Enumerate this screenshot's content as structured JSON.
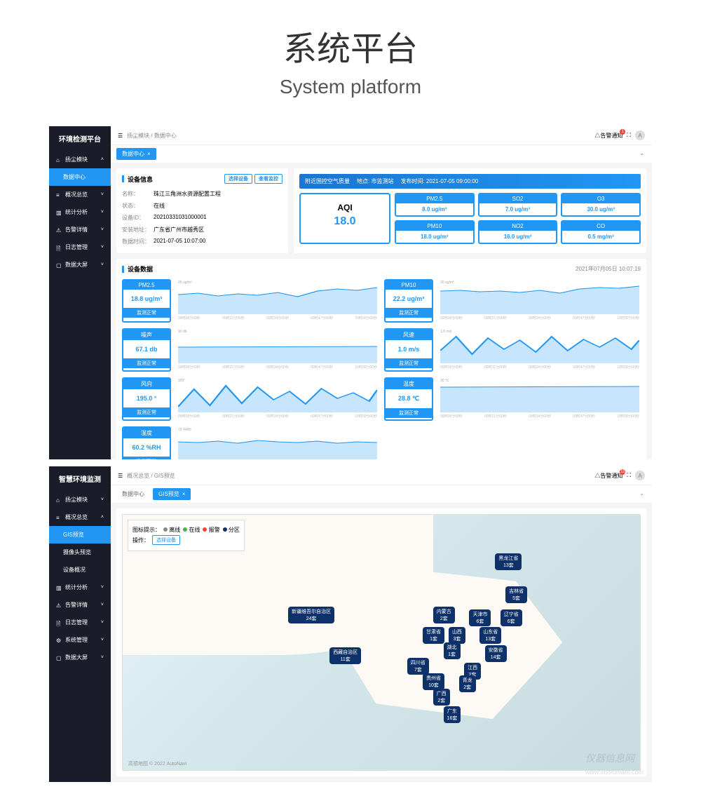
{
  "header": {
    "title_cn": "系统平台",
    "title_en": "System platform"
  },
  "dashboard1": {
    "sidebar": {
      "title": "环境检测平台",
      "items": [
        {
          "icon": "home",
          "label": "扬尘模块",
          "expanded": true
        },
        {
          "icon": "",
          "label": "数据中心",
          "active": true,
          "sub": true
        },
        {
          "icon": "bars",
          "label": "概况总览"
        },
        {
          "icon": "chart",
          "label": "统计分析"
        },
        {
          "icon": "warn",
          "label": "告警详情"
        },
        {
          "icon": "doc",
          "label": "日志管理"
        },
        {
          "icon": "screen",
          "label": "数据大屏"
        }
      ]
    },
    "breadcrumb": "扬尘模块 / 数据中心",
    "user_label": "告警通知",
    "notif_count": "1",
    "avatar_initial": "A",
    "tabs": [
      {
        "label": "数据中心",
        "closable": true
      }
    ],
    "device_info": {
      "title": "设备信息",
      "btn_select": "选择设备",
      "btn_view": "查看监控",
      "rows": [
        {
          "lbl": "名称：",
          "val": "珠江三角洲水资源配置工程"
        },
        {
          "lbl": "状态：",
          "val": "在线"
        },
        {
          "lbl": "设备ID：",
          "val": "20210331031000001"
        },
        {
          "lbl": "安装地址：",
          "val": "广东省广州市越秀区"
        },
        {
          "lbl": "数据时间：",
          "val": "2021-07-05 10:07:00"
        }
      ]
    },
    "air": {
      "header_title": "附近国控空气质量",
      "header_site": "地点: 市监测站",
      "header_time": "发布时间: 2021-07-05 09:00:00",
      "aqi_label": "AQI",
      "aqi_value": "18.0",
      "pollutants": [
        {
          "name": "PM2.5",
          "val": "8.0 ug/m³"
        },
        {
          "name": "SO2",
          "val": "7.0 ug/m³"
        },
        {
          "name": "O3",
          "val": "30.0 ug/m³"
        },
        {
          "name": "PM10",
          "val": "18.0 ug/m³"
        },
        {
          "name": "NO2",
          "val": "16.0 ug/m³"
        },
        {
          "name": "CO",
          "val": "0.5 mg/m³"
        }
      ]
    },
    "device_data": {
      "title": "设备数据",
      "timestamp": "2021年07月05日 10:07:19",
      "status_normal": "监测正常",
      "metrics": [
        {
          "name": "PM2.5",
          "val": "18.8 ug/m³",
          "ymax": "25 ug/m³"
        },
        {
          "name": "PM10",
          "val": "22.2 ug/m³",
          "ymax": "30 ug/m³"
        },
        {
          "name": "噪声",
          "val": "67.1 db",
          "ymax": "90 db"
        },
        {
          "name": "风速",
          "val": "1.0 m/s",
          "ymax": "1.8 m/s"
        },
        {
          "name": "风向",
          "val": "195.0 °",
          "ymax": "300°"
        },
        {
          "name": "温度",
          "val": "28.8 ℃",
          "ymax": "30 ℃"
        },
        {
          "name": "湿度",
          "val": "60.2 %RH",
          "ymax": "70 %RH"
        }
      ],
      "x_ticks": [
        "09时08分00秒",
        "09时21分00秒",
        "09时34分00秒",
        "09时47分00秒",
        "10时00分00秒"
      ]
    }
  },
  "dashboard2": {
    "sidebar": {
      "title": "智慧环境监测",
      "items": [
        {
          "icon": "home",
          "label": "扬尘模块"
        },
        {
          "icon": "bars",
          "label": "概况总览",
          "expanded": true
        },
        {
          "icon": "",
          "label": "GIS预览",
          "active": true,
          "sub": true
        },
        {
          "icon": "",
          "label": "摄像头预览",
          "sub": true
        },
        {
          "icon": "",
          "label": "设备概况",
          "sub": true
        },
        {
          "icon": "chart",
          "label": "统计分析"
        },
        {
          "icon": "warn",
          "label": "告警详情"
        },
        {
          "icon": "doc",
          "label": "日志管理"
        },
        {
          "icon": "gear",
          "label": "系统管理"
        },
        {
          "icon": "screen",
          "label": "数据大屏"
        }
      ]
    },
    "breadcrumb": "概况总览 / GIS预览",
    "user_label": "告警通知",
    "notif_count": "11",
    "avatar_initial": "A",
    "tabs": [
      {
        "label": "数据中心",
        "plain": true
      },
      {
        "label": "GIS预览",
        "closable": true
      }
    ],
    "legend": {
      "title": "图标提示：",
      "items": [
        {
          "color": "#888",
          "label": "离线"
        },
        {
          "color": "#4caf50",
          "label": "在线"
        },
        {
          "color": "#f44336",
          "label": "报警"
        },
        {
          "color": "#0d3168",
          "label": "分区"
        }
      ],
      "op_label": "操作：",
      "op_btn": "选择设备"
    },
    "markers": [
      {
        "name": "黑龙江省",
        "count": "13套",
        "x": 72,
        "y": 15
      },
      {
        "name": "吉林省",
        "count": "5套",
        "x": 74,
        "y": 28
      },
      {
        "name": "新疆维吾尔自治区",
        "count": "24套",
        "x": 32,
        "y": 36
      },
      {
        "name": "内蒙古",
        "count": "2套",
        "x": 60,
        "y": 36
      },
      {
        "name": "天津市",
        "count": "6套",
        "x": 67,
        "y": 37
      },
      {
        "name": "辽宁省",
        "count": "6套",
        "x": 73,
        "y": 37
      },
      {
        "name": "甘肃省",
        "count": "1套",
        "x": 58,
        "y": 44
      },
      {
        "name": "山西",
        "count": "3套",
        "x": 63,
        "y": 44
      },
      {
        "name": "山东省",
        "count": "13套",
        "x": 69,
        "y": 44
      },
      {
        "name": "西藏自治区",
        "count": "11套",
        "x": 40,
        "y": 52
      },
      {
        "name": "湖北",
        "count": "1套",
        "x": 62,
        "y": 50
      },
      {
        "name": "安徽省",
        "count": "14套",
        "x": 70,
        "y": 51
      },
      {
        "name": "四川省",
        "count": "7套",
        "x": 55,
        "y": 56
      },
      {
        "name": "江西",
        "count": "2套",
        "x": 66,
        "y": 58
      },
      {
        "name": "贵州省",
        "count": "10套",
        "x": 58,
        "y": 62
      },
      {
        "name": "青龙",
        "count": "2套",
        "x": 65,
        "y": 63
      },
      {
        "name": "广西",
        "count": "2套",
        "x": 60,
        "y": 68
      },
      {
        "name": "广东",
        "count": "16套",
        "x": 62,
        "y": 75
      }
    ],
    "attribution": "高德地图 © 2022 AutoNavi"
  },
  "watermark": "仪器信息网",
  "watermark_url": "www.instrument.com"
}
